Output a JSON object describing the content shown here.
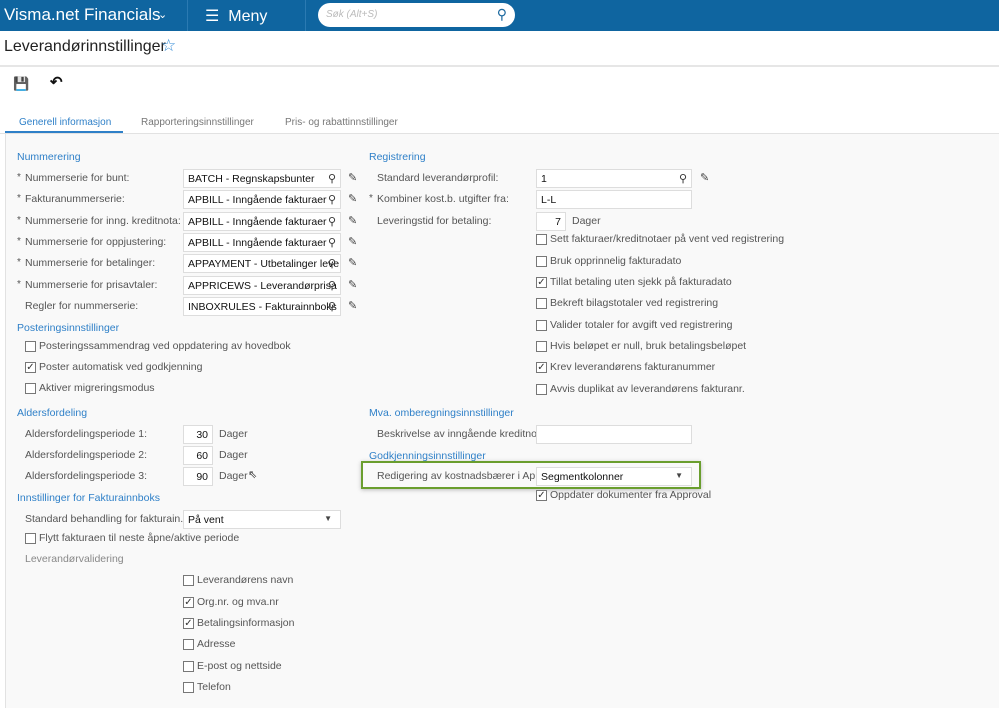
{
  "topbar": {
    "brand": "Visma.net Financials",
    "menu": "Meny",
    "search_placeholder": "Søk (Alt+S)"
  },
  "page": {
    "title": "Leverandørinnstillinger"
  },
  "tabs": [
    {
      "label": "Generell informasjon",
      "active": true
    },
    {
      "label": "Rapporteringsinnstillinger"
    },
    {
      "label": "Pris- og rabattinnstillinger"
    }
  ],
  "left": {
    "nummerering": {
      "title": "Nummerering",
      "rows": [
        {
          "label": "Nummerserie for bunt:",
          "required": true,
          "value": "BATCH - Regnskapsbunter"
        },
        {
          "label": "Fakturanummerserie:",
          "required": true,
          "value": "APBILL - Inngående fakturaer"
        },
        {
          "label": "Nummerserie for inng. kreditnota:",
          "required": true,
          "value": "APBILL - Inngående fakturaer"
        },
        {
          "label": "Nummerserie for oppjustering:",
          "required": true,
          "value": "APBILL - Inngående fakturaer"
        },
        {
          "label": "Nummerserie for betalinger:",
          "required": true,
          "value": "APPAYMENT - Utbetalinger leve"
        },
        {
          "label": "Nummerserie for prisavtaler:",
          "required": true,
          "value": "APPRICEWS - Leverandørprisa"
        },
        {
          "label": "Regler for nummerserie:",
          "required": false,
          "value": "INBOXRULES - Fakturainnboks"
        }
      ]
    },
    "postering": {
      "title": "Posteringsinnstillinger",
      "checks": [
        {
          "label": "Posteringssammendrag ved oppdatering av hovedbok",
          "checked": false
        },
        {
          "label": "Poster automatisk ved godkjenning",
          "checked": true
        },
        {
          "label": "Aktiver migreringsmodus",
          "checked": false
        }
      ]
    },
    "aldersfordeling": {
      "title": "Aldersfordeling",
      "unit": "Dager",
      "rows": [
        {
          "label": "Aldersfordelingsperiode 1:",
          "value": "30"
        },
        {
          "label": "Aldersfordelingsperiode 2:",
          "value": "60"
        },
        {
          "label": "Aldersfordelingsperiode 3:",
          "value": "90"
        }
      ]
    },
    "innboks": {
      "title": "Innstillinger for Fakturainnboks",
      "std_label": "Standard behandling for fakturain...",
      "std_value": "På vent",
      "move": {
        "label": "Flytt fakturaen til neste åpne/aktive periode",
        "checked": false
      },
      "validering_label": "Leverandørvalidering",
      "checks": [
        {
          "label": "Leverandørens navn",
          "checked": false
        },
        {
          "label": "Org.nr. og mva.nr",
          "checked": true
        },
        {
          "label": "Betalingsinformasjon",
          "checked": true
        },
        {
          "label": "Adresse",
          "checked": false
        },
        {
          "label": "E-post og nettside",
          "checked": false
        },
        {
          "label": "Telefon",
          "checked": false
        }
      ]
    }
  },
  "right": {
    "registrering": {
      "title": "Registrering",
      "profil": {
        "label": "Standard leverandørprofil:",
        "value": "1"
      },
      "kombiner": {
        "label": "Kombiner kost.b. utgifter fra:",
        "value": "L-L"
      },
      "levtid": {
        "label": "Leveringstid for betaling:",
        "value": "7",
        "unit": "Dager"
      },
      "checks": [
        {
          "label": "Sett fakturaer/kreditnotaer på vent ved registrering",
          "checked": false
        },
        {
          "label": "Bruk opprinnelig fakturadato",
          "checked": false
        },
        {
          "label": "Tillat betaling uten sjekk på fakturadato",
          "checked": true
        },
        {
          "label": "Bekreft bilagstotaler ved registrering",
          "checked": false
        },
        {
          "label": "Valider totaler for avgift ved registrering",
          "checked": false
        },
        {
          "label": "Hvis beløpet er null, bruk betalingsbeløpet",
          "checked": false
        },
        {
          "label": "Krev leverandørens fakturanummer",
          "checked": true
        },
        {
          "label": "Avvis duplikat av leverandørens fakturanr.",
          "checked": false
        }
      ]
    },
    "mva": {
      "title": "Mva. omberegningsinnstillinger",
      "beskrivelse_label": "Beskrivelse av inngående kreditno...",
      "beskrivelse_value": ""
    },
    "godkjenning": {
      "title": "Godkjenningsinnstillinger",
      "redigering_label": "Redigering av kostnadsbærer i Ap...",
      "redigering_value": "Segmentkolonner",
      "oppdater": {
        "label": "Oppdater dokumenter fra Approval",
        "checked": true
      }
    }
  }
}
